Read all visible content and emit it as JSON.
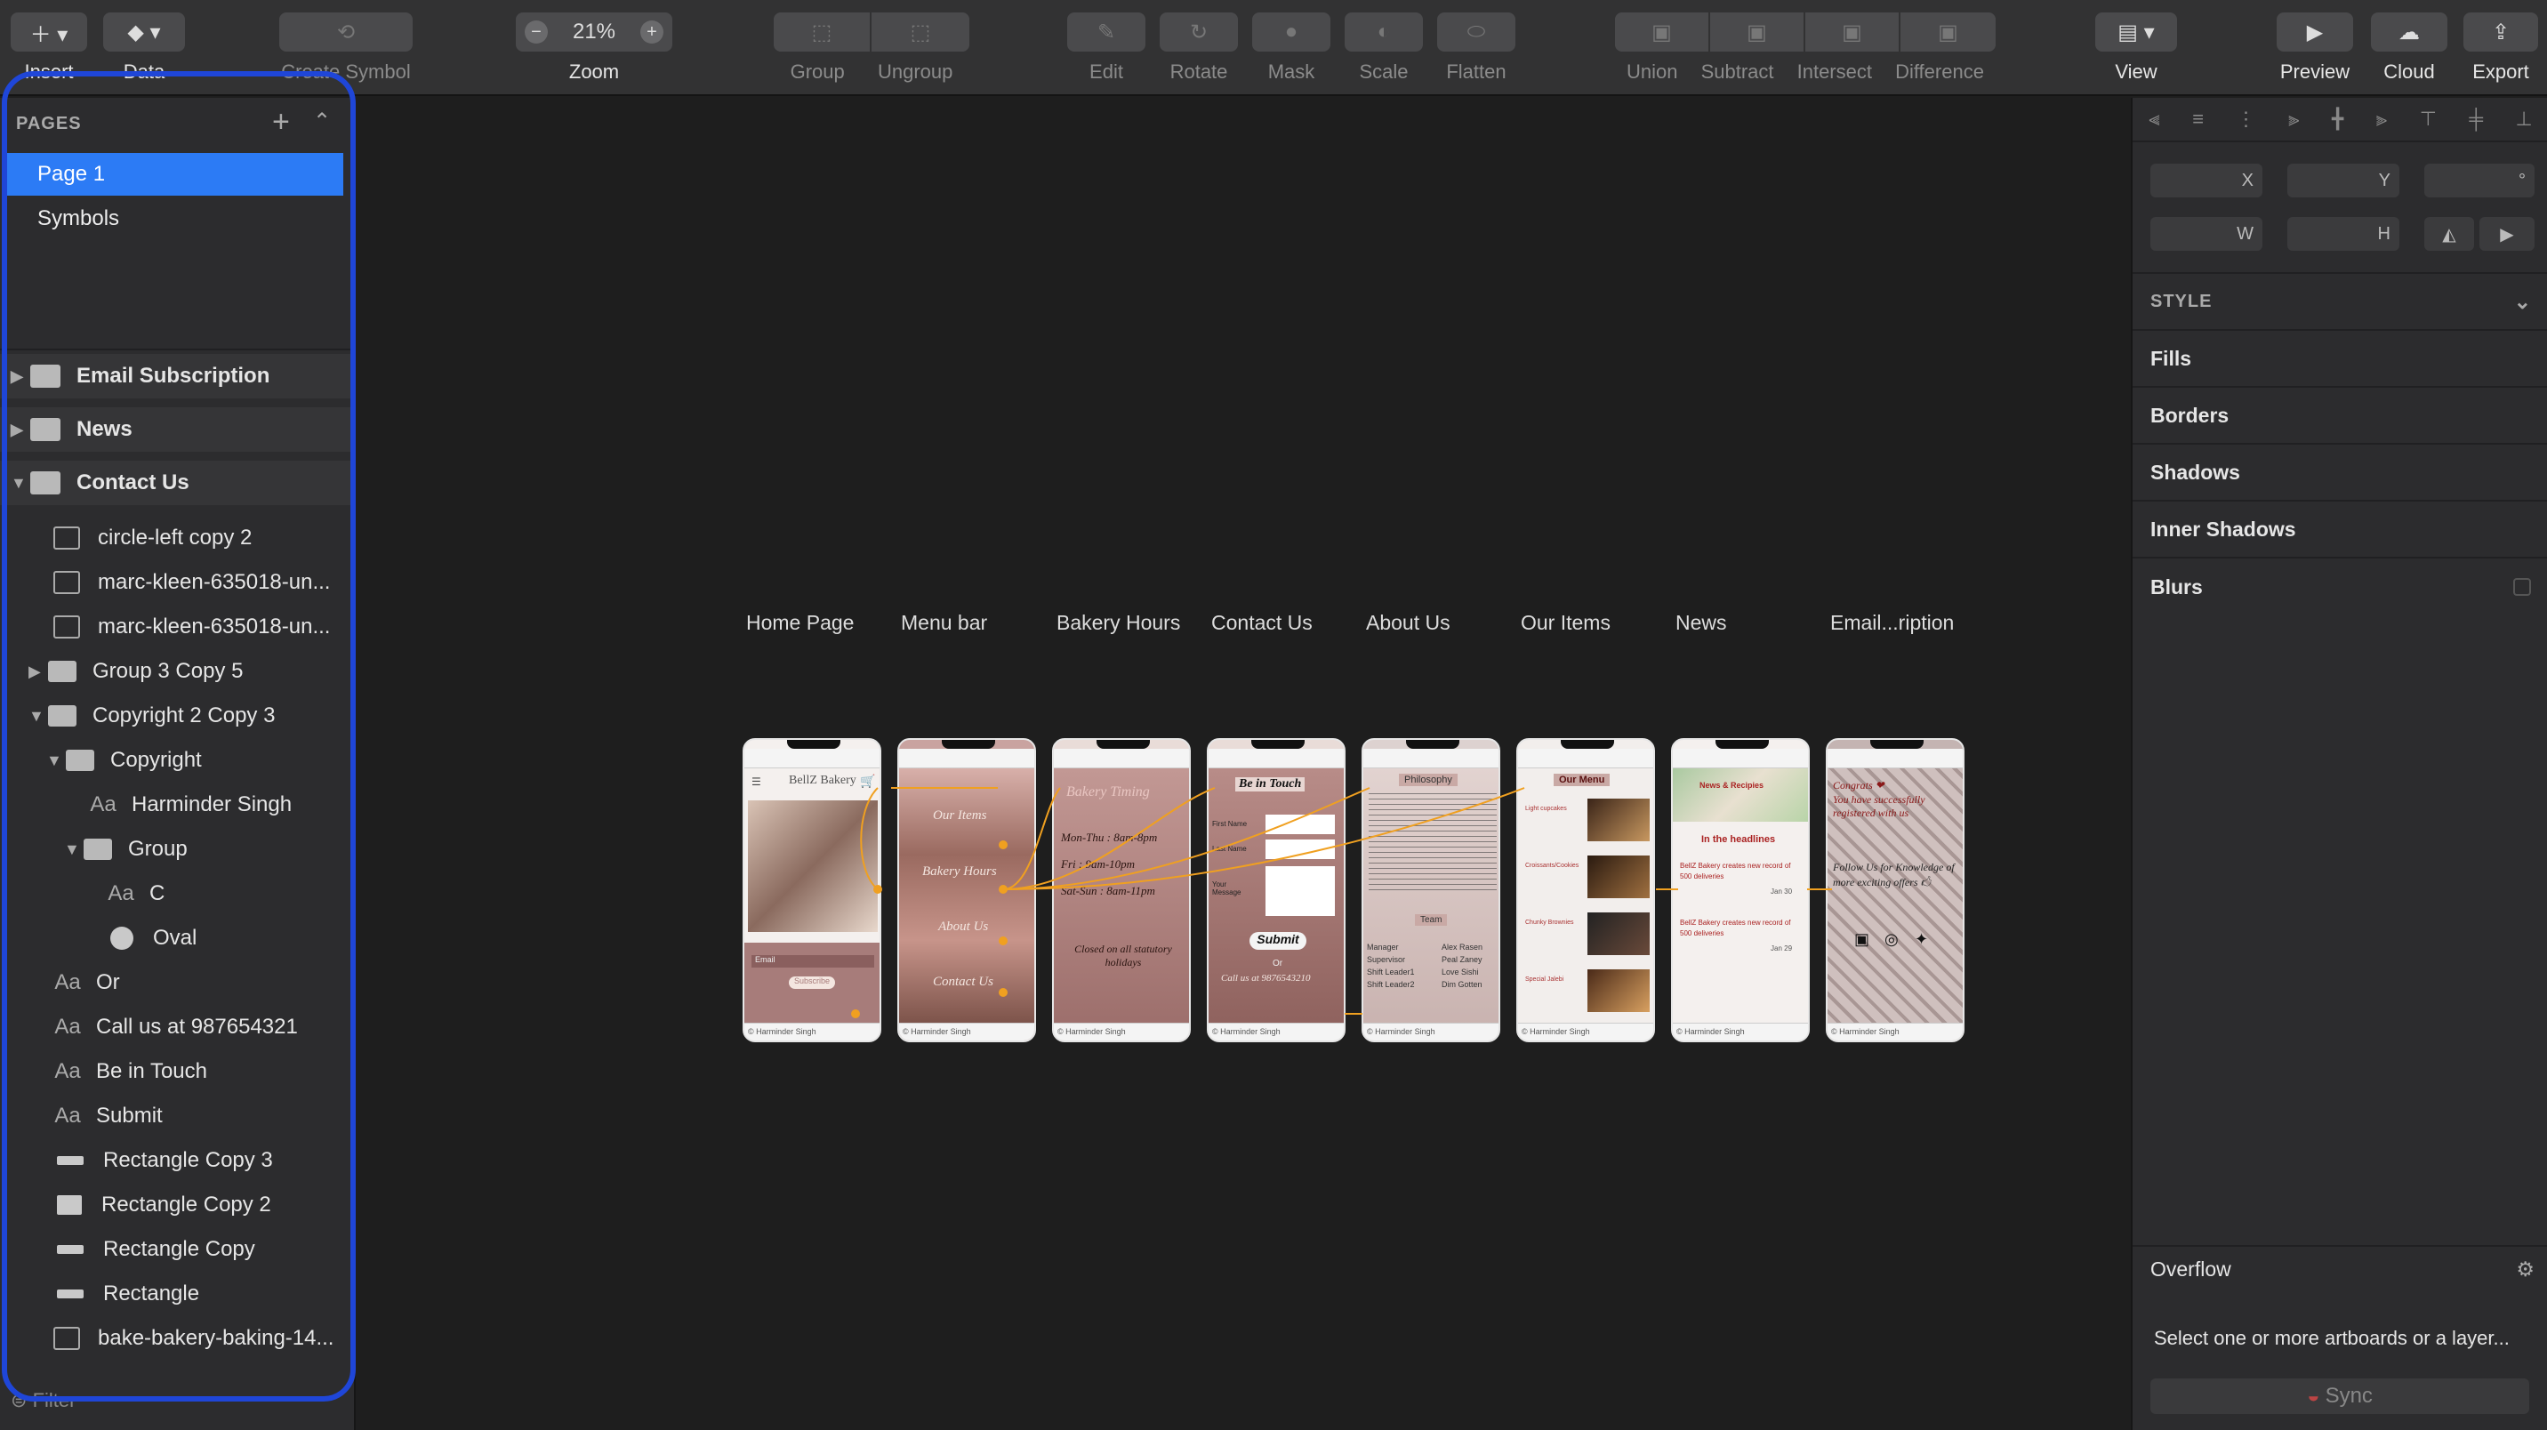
{
  "toolbar": {
    "insert": "Insert",
    "data": "Data",
    "create_symbol": "Create Symbol",
    "zoom_value": "21%",
    "zoom": "Zoom",
    "group": "Group",
    "ungroup": "Ungroup",
    "edit": "Edit",
    "rotate": "Rotate",
    "mask": "Mask",
    "scale": "Scale",
    "flatten": "Flatten",
    "union": "Union",
    "subtract": "Subtract",
    "intersect": "Intersect",
    "difference": "Difference",
    "view": "View",
    "preview": "Preview",
    "cloud": "Cloud",
    "export": "Export"
  },
  "pages": {
    "header": "PAGES",
    "items": [
      {
        "label": "Page 1",
        "selected": true
      },
      {
        "label": "Symbols",
        "selected": false
      }
    ]
  },
  "layers": [
    {
      "label": "Email Subscription",
      "type": "artboard",
      "expanded": false
    },
    {
      "label": "News",
      "type": "artboard",
      "expanded": false
    },
    {
      "label": "Contact Us",
      "type": "artboard",
      "expanded": true
    },
    {
      "label": "circle-left copy 2",
      "type": "image"
    },
    {
      "label": "marc-kleen-635018-un...",
      "type": "image"
    },
    {
      "label": "marc-kleen-635018-un...",
      "type": "image"
    },
    {
      "label": "Group 3 Copy 5",
      "type": "folder"
    },
    {
      "label": "Copyright 2 Copy 3",
      "type": "folder"
    },
    {
      "label": "Copyright",
      "type": "folder"
    },
    {
      "label": "Harminder Singh",
      "type": "text"
    },
    {
      "label": "Group",
      "type": "folder"
    },
    {
      "label": "C",
      "type": "text"
    },
    {
      "label": "Oval",
      "type": "oval"
    },
    {
      "label": "Or",
      "type": "text"
    },
    {
      "label": "Call us at 987654321",
      "type": "text"
    },
    {
      "label": "Be in Touch",
      "type": "text"
    },
    {
      "label": "Submit",
      "type": "text"
    },
    {
      "label": "Rectangle Copy 3",
      "type": "rect"
    },
    {
      "label": "Rectangle Copy 2",
      "type": "rectbox"
    },
    {
      "label": "Rectangle Copy",
      "type": "rect"
    },
    {
      "label": "Rectangle",
      "type": "rect"
    },
    {
      "label": "bake-bakery-baking-14...",
      "type": "image"
    }
  ],
  "filter": "Filter",
  "artboards": [
    {
      "title": "Home Page"
    },
    {
      "title": "Menu bar"
    },
    {
      "title": "Bakery Hours"
    },
    {
      "title": "Contact Us"
    },
    {
      "title": "About Us"
    },
    {
      "title": "Our Items"
    },
    {
      "title": "News"
    },
    {
      "title": "Email...ription"
    }
  ],
  "board_text": {
    "home_logo": "BellZ Bakery",
    "home_email": "Email",
    "home_subscribe": "Subscribe",
    "menu_items": [
      "Our Items",
      "Bakery Hours",
      "About Us",
      "Contact Us"
    ],
    "hours_title": "Bakery Timing",
    "hours_lines": [
      "Mon-Thu : 8am-8pm",
      "Fri : 9am-10pm",
      "Sat-Sun : 8am-11pm",
      "Closed on all statutory holidays"
    ],
    "contact_title": "Be in Touch",
    "contact_first": "First Name",
    "contact_last": "Last Name",
    "contact_msg": "Your Message",
    "contact_submit": "Submit",
    "contact_or": "Or",
    "contact_call": "Call us at 9876543210",
    "about_philosophy": "Philosophy",
    "about_team": "Team",
    "about_roles": [
      "Manager",
      "Supervisor",
      "Shift Leader1",
      "Shift Leader2"
    ],
    "about_names": [
      "Alex Rasen",
      "Peal Zaney",
      "Love Sishi",
      "Dim Gotten"
    ],
    "items_title": "Our Menu",
    "items_list": [
      "Light cupcakes",
      "Croissants/Cookies",
      "Chunky Brownies",
      "Special Jalebi"
    ],
    "news_header": "News & Recipies",
    "news_headlines": "In the headlines",
    "news_item1": "BellZ Bakery creates new record of 500 deliveries",
    "news_date1": "Jan 30",
    "news_item2": "BellZ Bakery creates new record of 500 deliveries",
    "news_date2": "Jan 29",
    "email_congrats": "Congrats ❤",
    "email_msg": "You have successfully registered with us",
    "email_follow": "Follow Us for Knowledge of more exciting offers 🖒",
    "footer": "© Harminder Singh"
  },
  "inspector": {
    "x_label": "X",
    "y_label": "Y",
    "deg_label": "°",
    "w_label": "W",
    "h_label": "H",
    "style_header": "STYLE",
    "fills": "Fills",
    "borders": "Borders",
    "shadows": "Shadows",
    "inner_shadows": "Inner Shadows",
    "blurs": "Blurs",
    "overflow": "Overflow",
    "hint": "Select one or more artboards or a layer...",
    "sync": "Sync"
  },
  "colors": {
    "selection": "#2c7bf5",
    "annotation": "#1f46d8",
    "flow": "#f0a020",
    "board_rose": "#b98a86"
  }
}
